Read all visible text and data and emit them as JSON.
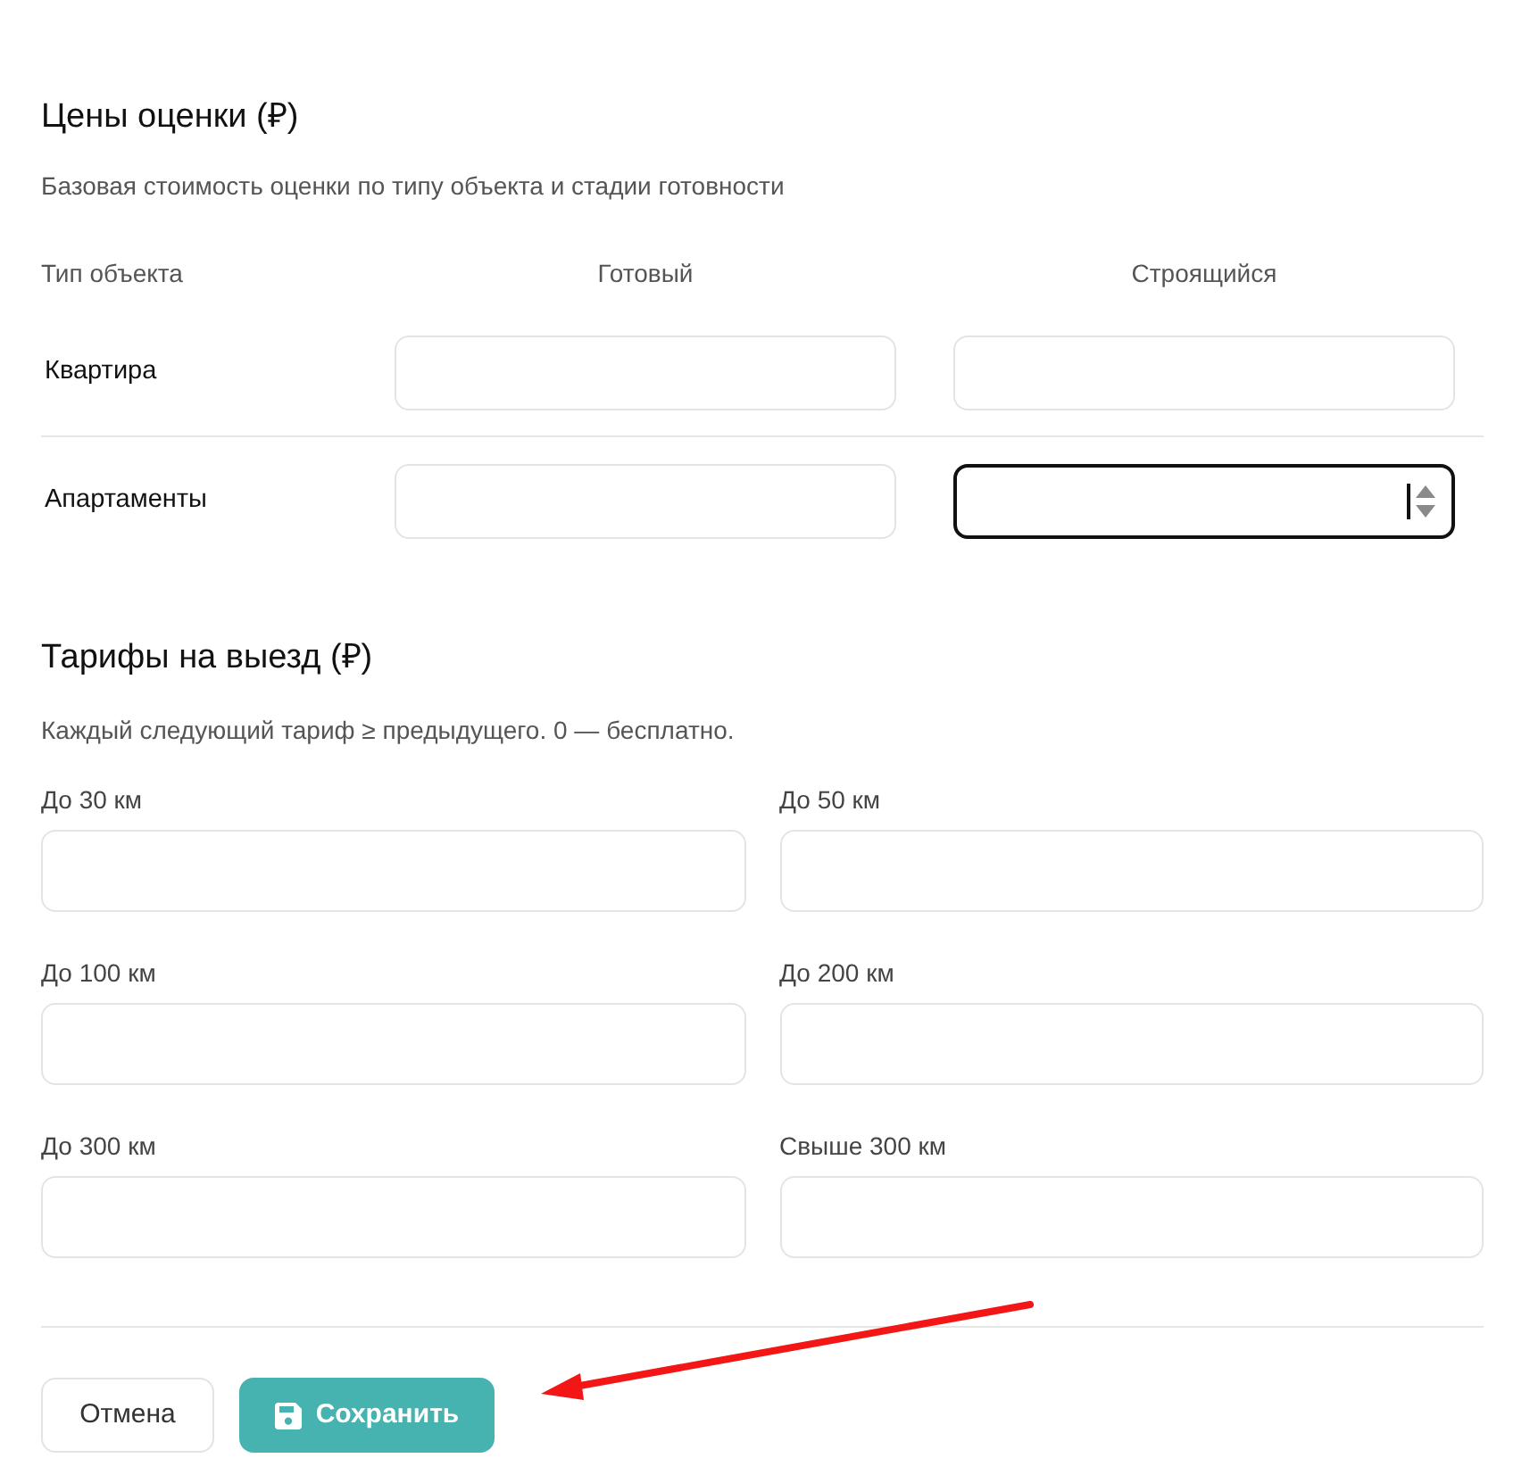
{
  "pricing": {
    "title": "Цены оценки (₽)",
    "description": "Базовая стоимость оценки по типу объекта и стадии готовности",
    "columns": [
      "Тип объекта",
      "Готовый",
      "Строящийся"
    ],
    "rows": [
      {
        "label": "Квартира",
        "fields": [
          {
            "focused": false
          },
          {
            "focused": false
          }
        ]
      },
      {
        "label": "Апартаменты",
        "fields": [
          {
            "focused": false
          },
          {
            "focused": true
          }
        ]
      }
    ]
  },
  "tariffs": {
    "title": "Тарифы на выезд (₽)",
    "description": "Каждый следующий тариф ≥ предыдущего. 0 — бесплатно.",
    "fields": [
      {
        "label": "До 30 км"
      },
      {
        "label": "До 50 км"
      },
      {
        "label": "До 100 км"
      },
      {
        "label": "До 200 км"
      },
      {
        "label": "До 300 км"
      },
      {
        "label": "Свыше 300 км"
      }
    ]
  },
  "buttons": [
    {
      "label": "Отмена",
      "kind": "secondary"
    },
    {
      "label": "Сохранить",
      "kind": "primary"
    }
  ],
  "annotations": [
    {
      "kind": "arrow"
    }
  ]
}
